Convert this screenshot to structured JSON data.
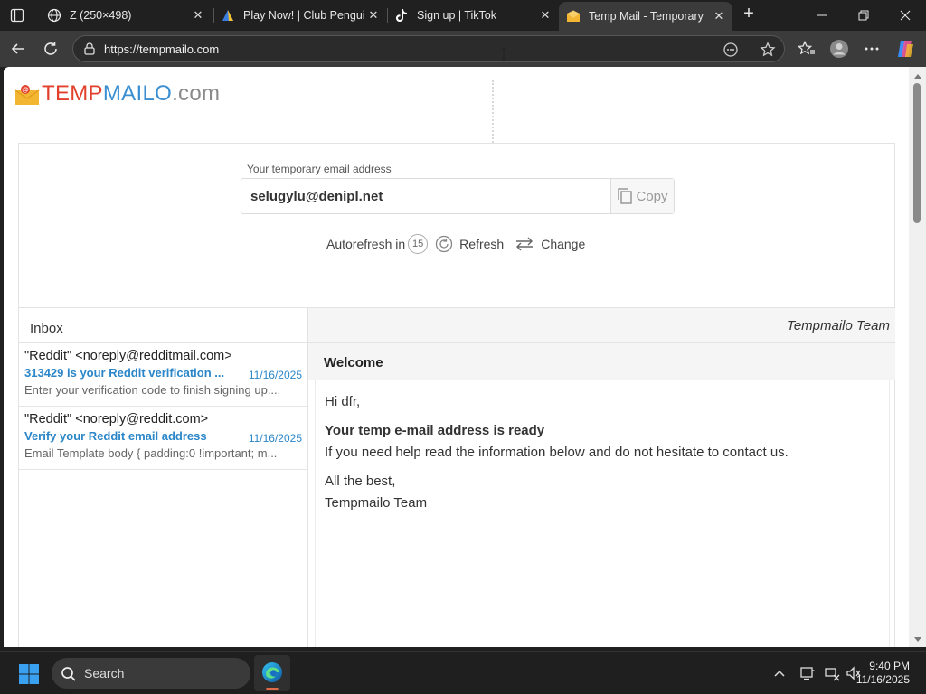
{
  "browser": {
    "tabs": [
      {
        "title": "Z (250×498)",
        "favicon": "globe-icon",
        "active": false
      },
      {
        "title": "Play Now! | Club Penguin",
        "favicon": "club-penguin-icon",
        "active": false
      },
      {
        "title": "Sign up | TikTok",
        "favicon": "tiktok-icon",
        "active": false
      },
      {
        "title": "Temp Mail - Temporary",
        "favicon": "envelope-icon",
        "active": true
      }
    ],
    "url": "https://tempmailo.com"
  },
  "site": {
    "logo": {
      "part1": "TEMP",
      "part2": "MAILO",
      "part3": ".com"
    },
    "address_label": "Your temporary email address",
    "email_address": "selugylu@denipl.net",
    "copy_label": "Copy",
    "autorefresh_label": "Autorefresh in",
    "autorefresh_seconds": "15",
    "refresh_label": "Refresh",
    "change_label": "Change",
    "inbox_title": "Inbox",
    "messages": [
      {
        "from": "\"Reddit\" <noreply@redditmail.com>",
        "subject": "313429 is your Reddit verification ...",
        "date": "11/16/2025",
        "preview": "Enter your verification code to finish signing up...."
      },
      {
        "from": "\"Reddit\" <noreply@reddit.com>",
        "subject": "Verify your Reddit email address",
        "date": "11/16/2025",
        "preview": "Email Template body { padding:0 !important; m..."
      }
    ],
    "reader": {
      "sender": "Tempmailo Team",
      "subject": "Welcome",
      "greeting": "Hi dfr,",
      "heading": "Your temp e-mail address is ready",
      "body": "If you need help read the information below and do not hesitate to contact us.",
      "signoff": "All the best,",
      "signature": "Tempmailo Team"
    }
  },
  "taskbar": {
    "search_label": "Search",
    "time": "9:40 PM",
    "date": "11/16/2025"
  },
  "colors": {
    "logo_red": "#e2402c",
    "logo_blue": "#3b8fd1",
    "link_blue": "#2a86c8"
  }
}
